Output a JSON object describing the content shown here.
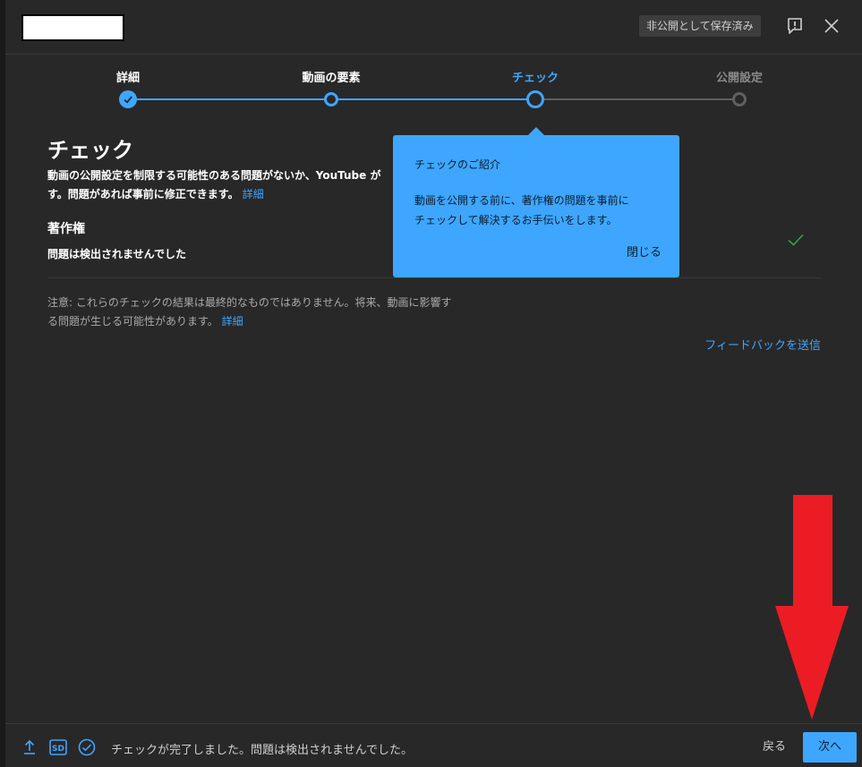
{
  "header": {
    "saved_badge": "非公開として保存済み",
    "icons": [
      "feedback-icon",
      "close-icon"
    ]
  },
  "stepper": {
    "steps": [
      {
        "label": "詳細",
        "state": "done"
      },
      {
        "label": "動画の要素",
        "state": "visited"
      },
      {
        "label": "チェック",
        "state": "active"
      },
      {
        "label": "公開設定",
        "state": "upcoming"
      }
    ]
  },
  "main": {
    "title": "チェック",
    "description_line1": "動画の公開設定を制限する可能性のある問題がないか、YouTube が",
    "description_line2": "す。問題があれば事前に修正できます。",
    "description_link": "詳細",
    "copyright": {
      "title": "著作権",
      "status": "問題は検出されませんでした"
    },
    "note_line1": "注意: これらのチェックの結果は最終的なものではありません。将来、動画に影響す",
    "note_line2": "る問題が生じる可能性があります。",
    "note_link": "詳細",
    "feedback_link": "フィードバックを送信"
  },
  "tooltip": {
    "title": "チェックのご紹介",
    "body_line1": "動画を公開する前に、著作権の問題を事前に",
    "body_line2": "チェックして解決するお手伝いをします。",
    "close_label": "閉じる"
  },
  "footer": {
    "icons": [
      "upload-icon",
      "sd-icon",
      "check-circle-icon"
    ],
    "status_text": "チェックが完了しました。問題は検出されませんでした。",
    "back_label": "戻る",
    "next_label": "次へ"
  },
  "colors": {
    "accent": "#3ea6ff",
    "dialog_bg": "#282828",
    "inactive": "#606060",
    "annotation_arrow": "#ec1c24",
    "check_green": "#2ba640"
  }
}
